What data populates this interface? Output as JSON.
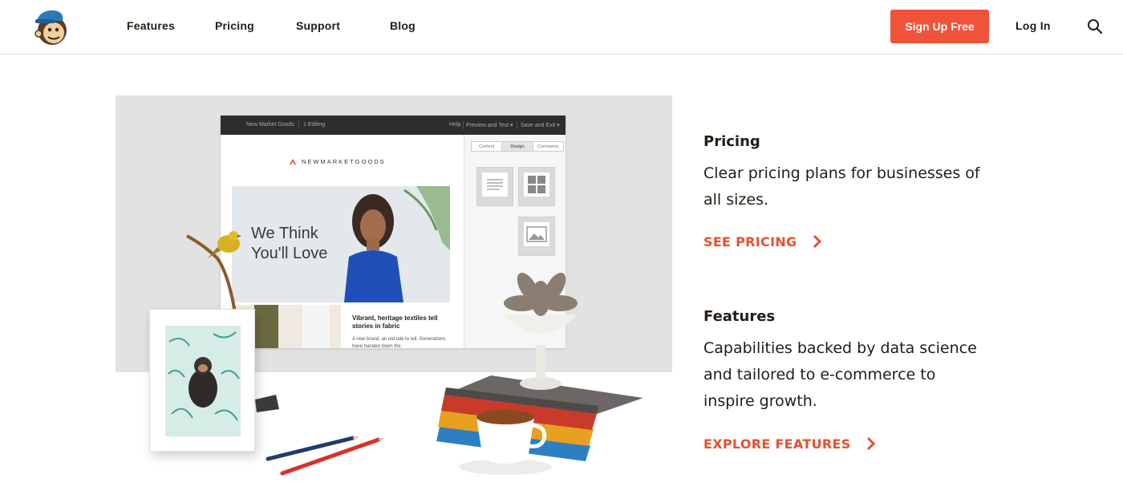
{
  "nav": {
    "features": "Features",
    "pricing": "Pricing",
    "support": "Support",
    "blog": "Blog",
    "signup": "Sign Up Free",
    "login": "Log In"
  },
  "icons": {
    "logo": "mailchimp-freddie-logo",
    "search": "search-icon",
    "chevron": "chevron-right-icon"
  },
  "colors": {
    "accent": "#f0533a",
    "cta_text": "#e8502e",
    "text": "#241c15"
  },
  "app_mockup": {
    "bar_left": "New Market Goods",
    "bar_mid": "1 Editing",
    "bar_help": "Help",
    "bar_preview": "Preview and Test ▾",
    "bar_save": "Save and Exit ▾",
    "tabs": [
      "Content",
      "Design",
      "Comments"
    ],
    "brand": "NEWMARKETGOODS",
    "banner_line1": "We Think",
    "banner_line2": "You'll Love",
    "story_head": "Vibrant, heritage textiles tell stories in fabric",
    "story_body": "A new brand, an old tale to tell. Generations have handed down the"
  },
  "pricing": {
    "title": "Pricing",
    "desc": "Clear pricing plans for businesses of all sizes.",
    "cta": "SEE PRICING"
  },
  "features": {
    "title": "Features",
    "desc": "Capabilities backed by data science and tailored to e-commerce to inspire growth.",
    "cta": "EXPLORE FEATURES"
  }
}
